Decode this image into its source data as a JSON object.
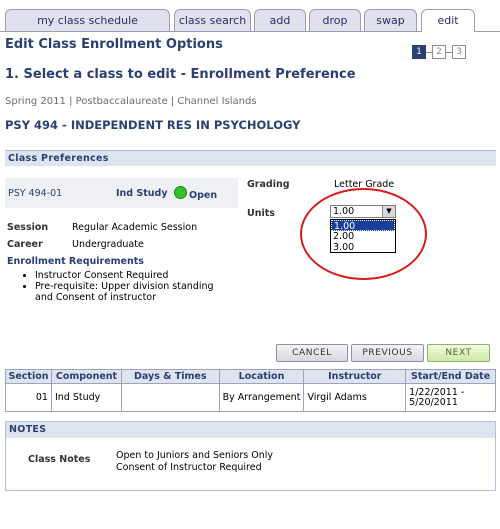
{
  "tabs": [
    {
      "label": "my class schedule",
      "active": false
    },
    {
      "label": "class search",
      "active": false
    },
    {
      "label": "add",
      "active": false
    },
    {
      "label": "drop",
      "active": false
    },
    {
      "label": "swap",
      "active": false
    },
    {
      "label": "edit",
      "active": true
    }
  ],
  "page_title": "Edit Class Enrollment Options",
  "step_title": "1.  Select a class to edit - Enrollment Preference",
  "steps": [
    "1",
    "2",
    "3"
  ],
  "term_info": "Spring 2011 | Postbaccalaureate | Channel Islands",
  "class_heading": "PSY  494 - INDEPENDENT RES IN PSYCHOLOGY",
  "class_prefs": {
    "section_title": "Class Preferences",
    "class_code": "PSY  494-01",
    "component": "Ind Study",
    "status": "Open",
    "session_label": "Session",
    "session_value": "Regular Academic Session",
    "career_label": "Career",
    "career_value": "Undergraduate",
    "req_label": "Enrollment Requirements",
    "requirements": [
      "Instructor Consent Required",
      "Pre-requisite: Upper division standing and Consent of instructor"
    ],
    "grading_label": "Grading",
    "grading_value": "Letter Grade",
    "units_label": "Units",
    "units_selected": "1.00",
    "units_options": [
      "1.00",
      "2.00",
      "3.00"
    ]
  },
  "buttons": {
    "cancel": "CANCEL",
    "previous": "PREVIOUS",
    "next": "NEXT"
  },
  "table": {
    "headers": [
      "Section",
      "Component",
      "Days & Times",
      "Location",
      "Instructor",
      "Start/End Date"
    ],
    "rows": [
      {
        "section": "01",
        "component": "Ind Study",
        "days": "",
        "location": "By Arrangement",
        "instructor": "Virgil Adams",
        "dates": "1/22/2011 - 5/20/2011"
      }
    ]
  },
  "notes": {
    "section_title": "NOTES",
    "label": "Class Notes",
    "line1": "Open to Juniors and Seniors Only",
    "line2": "Consent of Instructor Required"
  },
  "colors": {
    "accent": "#2b3f72",
    "open_status": "#34c02a",
    "highlight": "#d81a1a"
  }
}
